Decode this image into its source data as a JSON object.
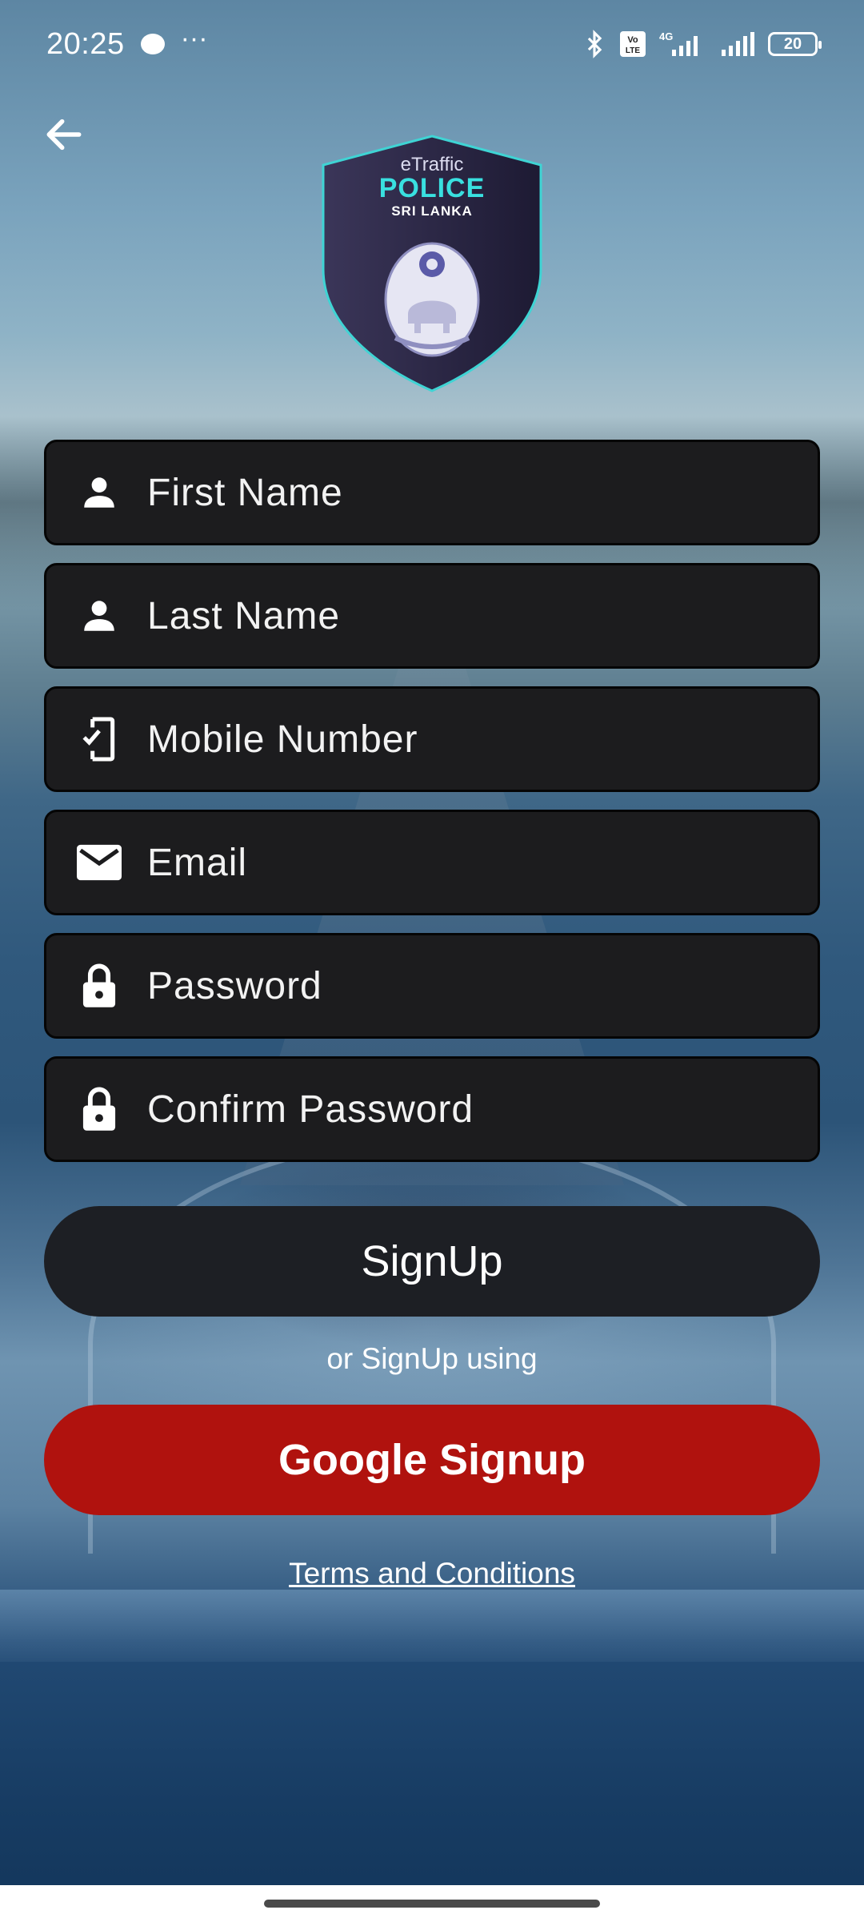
{
  "status_bar": {
    "time": "20:25",
    "more": "···",
    "network": "4G",
    "volte": "Vo LTE",
    "battery": "20"
  },
  "logo": {
    "line1": "eTraffic",
    "line2": "POLICE",
    "line3": "SRI LANKA"
  },
  "form": {
    "fields": [
      {
        "placeholder": "First Name",
        "icon": "person-icon"
      },
      {
        "placeholder": "Last Name",
        "icon": "person-icon"
      },
      {
        "placeholder": "Mobile Number",
        "icon": "phone-check-icon"
      },
      {
        "placeholder": "Email",
        "icon": "mail-icon"
      },
      {
        "placeholder": "Password",
        "icon": "lock-icon"
      },
      {
        "placeholder": "Confirm Password",
        "icon": "lock-icon"
      }
    ]
  },
  "buttons": {
    "signup": "SignUp",
    "or_text": "or SignUp using",
    "google": "Google Signup",
    "terms": "Terms and Conditions"
  },
  "colors": {
    "field_bg": "#1c1c1e",
    "signup_bg": "#1d1f24",
    "google_bg": "#b0120e",
    "badge_accent": "#39e0e0"
  }
}
